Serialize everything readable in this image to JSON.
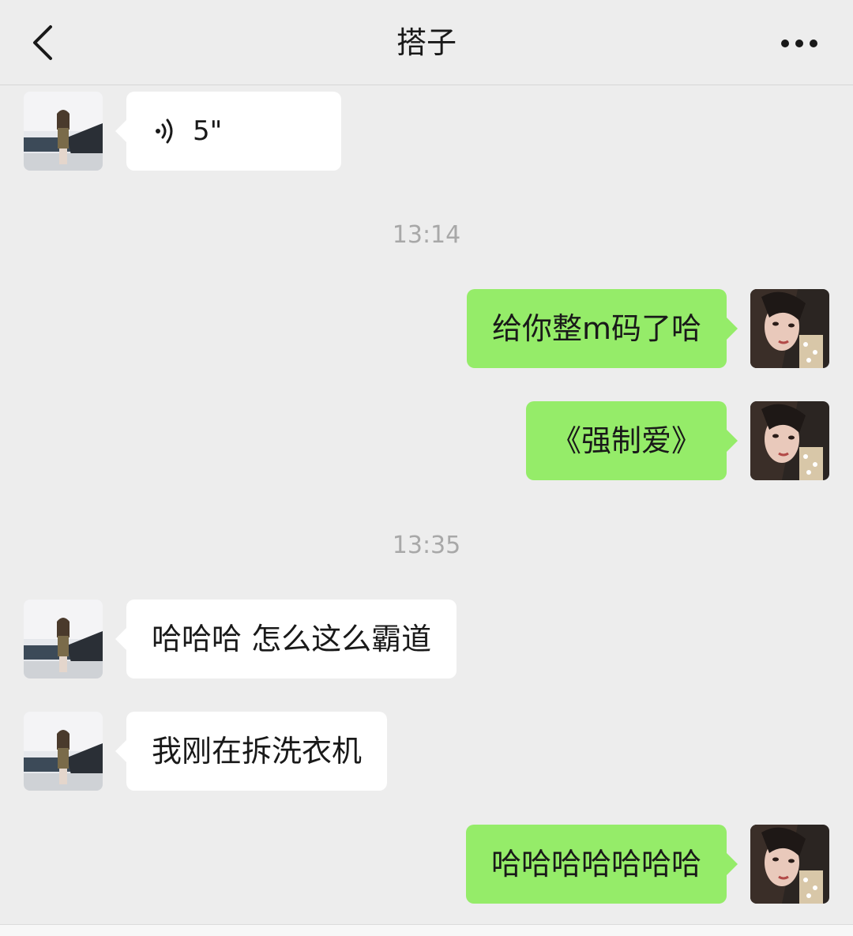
{
  "header": {
    "title": "搭子",
    "back_icon": "chevron-left-icon",
    "more_icon": "ellipsis-icon"
  },
  "messages": [
    {
      "side": "left",
      "type": "voice",
      "duration": "5\""
    },
    {
      "type": "timestamp",
      "text": "13:14"
    },
    {
      "side": "right",
      "type": "text",
      "text": "给你整m码了哈"
    },
    {
      "side": "right",
      "type": "text",
      "text": "《强制爱》"
    },
    {
      "type": "timestamp",
      "text": "13:35"
    },
    {
      "side": "left",
      "type": "text",
      "text": "哈哈哈 怎么这么霸道"
    },
    {
      "side": "left",
      "type": "text",
      "text": "我刚在拆洗衣机"
    },
    {
      "side": "right",
      "type": "text",
      "text": "哈哈哈哈哈哈哈"
    }
  ],
  "colors": {
    "background": "#ededed",
    "bubble_incoming": "#ffffff",
    "bubble_outgoing": "#95ec69",
    "timestamp": "#a8a8a8"
  }
}
